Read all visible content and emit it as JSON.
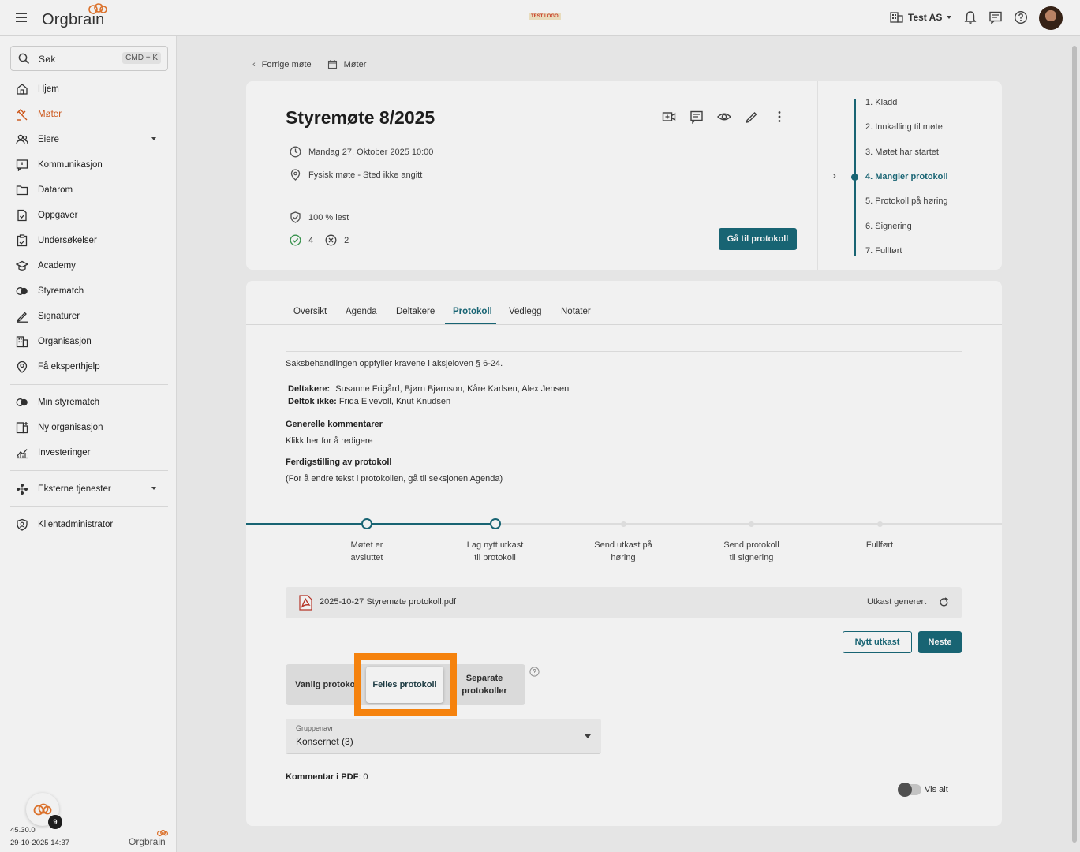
{
  "topbar": {
    "logo": "Orgbrain",
    "test_logo": "TEST LOGO",
    "org_name": "Test AS"
  },
  "sidebar": {
    "search_label": "Søk",
    "search_shortcut": "CMD + K",
    "items": [
      {
        "label": "Hjem",
        "icon": "home-icon"
      },
      {
        "label": "Møter",
        "icon": "gavel-icon"
      },
      {
        "label": "Eiere",
        "icon": "people-icon"
      },
      {
        "label": "Kommunikasjon",
        "icon": "chat-icon"
      },
      {
        "label": "Datarom",
        "icon": "folder-icon"
      },
      {
        "label": "Oppgaver",
        "icon": "task-icon"
      },
      {
        "label": "Undersøkelser",
        "icon": "survey-icon"
      },
      {
        "label": "Academy",
        "icon": "academy-icon"
      },
      {
        "label": "Styrematch",
        "icon": "match-icon"
      },
      {
        "label": "Signaturer",
        "icon": "signature-icon"
      },
      {
        "label": "Organisasjon",
        "icon": "building-icon"
      },
      {
        "label": "Få eksperthjelp",
        "icon": "expert-icon"
      },
      {
        "label": "Min styrematch",
        "icon": "match-icon"
      },
      {
        "label": "Ny organisasjon",
        "icon": "building-add-icon"
      },
      {
        "label": "Investeringer",
        "icon": "chart-icon"
      },
      {
        "label": "Eksterne tjenester",
        "icon": "services-icon"
      },
      {
        "label": "Klientadministrator",
        "icon": "shield-icon"
      }
    ],
    "version": "45.30.0",
    "datetime": "29-10-2025 14:37",
    "bottom_logo": "Orgbrain",
    "chat_badge": "9"
  },
  "breadcrumb": {
    "back": "Forrige møte",
    "section": "Møter"
  },
  "meeting": {
    "title": "Styremøte 8/2025",
    "date": "Mandag 27. Oktober 2025 10:00",
    "location": "Fysisk møte - Sted ikke angitt",
    "read": "100 % lest",
    "accepted": "4",
    "declined": "2",
    "goto_button": "Gå til protokoll"
  },
  "status_steps": [
    "1. Kladd",
    "2. Innkalling til møte",
    "3. Møtet har startet",
    "4. Mangler protokoll",
    "5. Protokoll på høring",
    "6. Signering",
    "7. Fullført"
  ],
  "current_step": 3,
  "tabs": [
    "Oversikt",
    "Agenda",
    "Deltakere",
    "Protokoll",
    "Vedlegg",
    "Notater"
  ],
  "active_tab": "Protokoll",
  "protocol": {
    "compliance": "Saksbehandlingen oppfyller kravene i aksjeloven § 6-24.",
    "participants_label": "Deltakere:",
    "participants": "Susanne Frigård, Bjørn Bjørnson, Kåre Karlsen, Alex Jensen",
    "absent_label": "Deltok ikke:",
    "absent": "Frida Elvevoll, Knut Knudsen",
    "comments_heading": "Generelle kommentarer",
    "comments_text": "Klikk her for å redigere",
    "finalize_heading": "Ferdigstilling av protokoll",
    "finalize_text": "(For å endre tekst i protokollen, gå til seksjonen Agenda)"
  },
  "progress": {
    "steps": [
      {
        "line1": "Møtet er",
        "line2": "avsluttet",
        "done": true
      },
      {
        "line1": "Lag nytt utkast",
        "line2": "til protokoll",
        "done": true
      },
      {
        "line1": "Send utkast på",
        "line2": "høring",
        "done": false
      },
      {
        "line1": "Send protokoll",
        "line2": "til signering",
        "done": false
      },
      {
        "line1": "Fullført",
        "line2": "",
        "done": false
      }
    ],
    "completed_fraction": 0.4
  },
  "file": {
    "name": "2025-10-27 Styremøte protokoll.pdf",
    "status": "Utkast generert"
  },
  "buttons": {
    "new_draft": "Nytt utkast",
    "next": "Neste"
  },
  "protocol_type": {
    "option1": "Vanlig protokoll",
    "option2": "Felles protokoll",
    "option3_line1": "Separate",
    "option3_line2": "protokoller",
    "selected": "Felles protokoll"
  },
  "group": {
    "label": "Gruppenavn",
    "value": "Konsernet (3)"
  },
  "pdf_comments": {
    "label": "Kommentar i PDF",
    "count": ": 0"
  },
  "show_all": "Vis alt",
  "colors": {
    "accent": "#1a6a7a",
    "brand_orange": "#d85a1a",
    "highlight": "#f5820d"
  }
}
